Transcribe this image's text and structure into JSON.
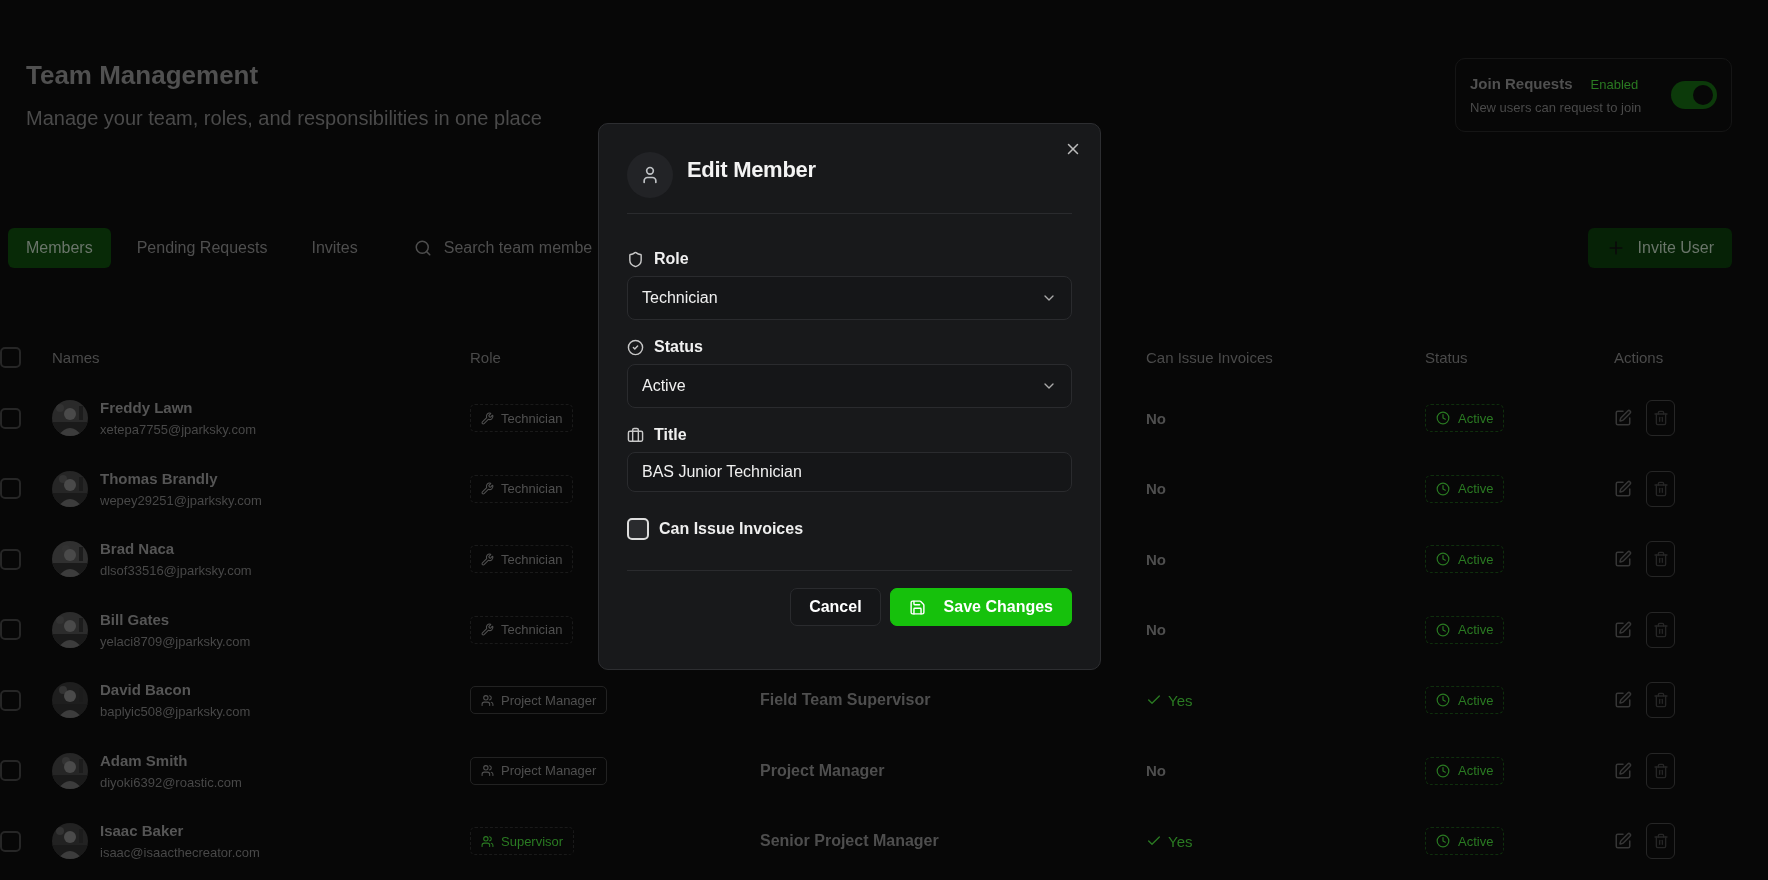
{
  "header": {
    "title": "Team Management",
    "subtitle": "Manage your team, roles, and responsibilities in one place"
  },
  "join_requests": {
    "title": "Join Requests",
    "state": "Enabled",
    "description": "New users can request to join",
    "on": true
  },
  "tabs": [
    {
      "label": "Members",
      "selected": true
    },
    {
      "label": "Pending Requests",
      "selected": false
    },
    {
      "label": "Invites",
      "selected": false
    }
  ],
  "search": {
    "placeholder": "Search team membe"
  },
  "invite_button": "Invite User",
  "table": {
    "select_all_checked": false,
    "columns": [
      "Names",
      "Role",
      "Can Issue Invoices",
      "Status",
      "Actions"
    ],
    "rows": [
      {
        "checked": false,
        "name": "Freddy Lawn",
        "email": "xetepa7755@jparksky.com",
        "role": {
          "label": "Technician",
          "kind": "technician"
        },
        "invoices": "No",
        "can_invoice": false,
        "status": "Active"
      },
      {
        "checked": false,
        "name": "Thomas Brandly",
        "email": "wepey29251@jparksky.com",
        "role": {
          "label": "Technician",
          "kind": "technician"
        },
        "invoices": "No",
        "can_invoice": false,
        "status": "Active"
      },
      {
        "checked": false,
        "name": "Brad Naca",
        "email": "dlsof33516@jparksky.com",
        "role": {
          "label": "Technician",
          "kind": "technician"
        },
        "invoices": "No",
        "can_invoice": false,
        "status": "Active"
      },
      {
        "checked": false,
        "name": "Bill Gates",
        "email": "yelaci8709@jparksky.com",
        "role": {
          "label": "Technician",
          "kind": "technician"
        },
        "invoices": "No",
        "can_invoice": false,
        "status": "Active"
      },
      {
        "checked": false,
        "name": "David Bacon",
        "email": "baplyic508@jparksky.com",
        "role": {
          "label": "Project Manager",
          "kind": "manager"
        },
        "title": "Field Team Supervisor",
        "invoices": "Yes",
        "can_invoice": true,
        "status": "Active"
      },
      {
        "checked": false,
        "name": "Adam Smith",
        "email": "diyoki6392@roastic.com",
        "role": {
          "label": "Project Manager",
          "kind": "manager"
        },
        "title": "Project Manager",
        "invoices": "No",
        "can_invoice": false,
        "status": "Active"
      },
      {
        "checked": false,
        "name": "Isaac Baker",
        "email": "isaac@isaacthecreator.com",
        "role": {
          "label": "Supervisor",
          "kind": "supervisor"
        },
        "title": "Senior Project Manager",
        "invoices": "Yes",
        "can_invoice": true,
        "status": "Active"
      }
    ]
  },
  "dialog": {
    "title": "Edit Member",
    "fields": [
      {
        "kind": "select",
        "label": "Role",
        "value": "Technician"
      },
      {
        "kind": "select",
        "label": "Status",
        "value": "Active"
      },
      {
        "kind": "text",
        "label": "Title",
        "value": "BAS Junior Technician"
      }
    ],
    "checkbox": {
      "label": "Can Issue Invoices",
      "checked": false
    },
    "buttons": [
      {
        "kind": "secondary",
        "label": "Cancel"
      },
      {
        "kind": "primary",
        "label": "Save Changes"
      }
    ]
  }
}
